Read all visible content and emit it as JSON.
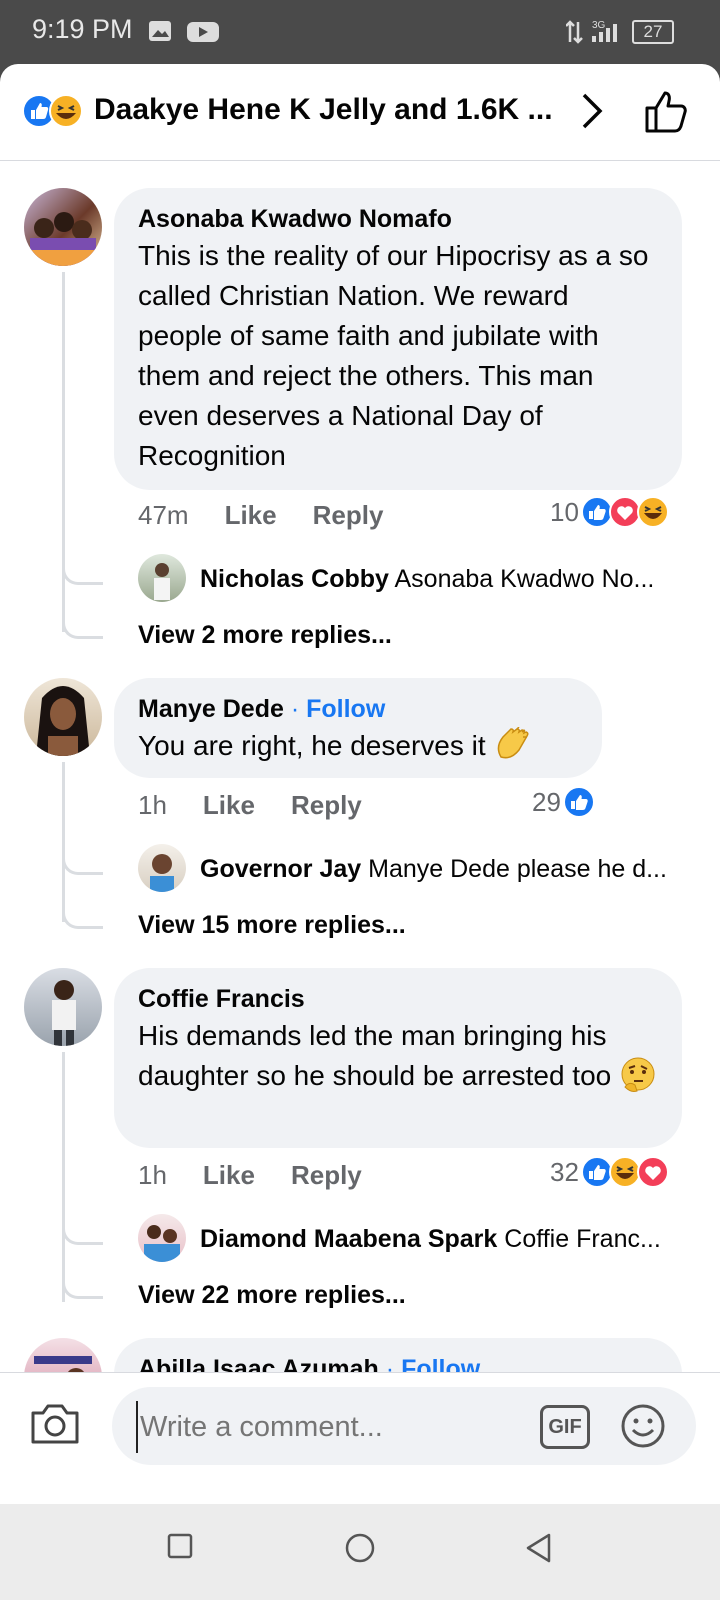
{
  "status_bar": {
    "time": "9:19 PM",
    "network": "3G",
    "battery": "27"
  },
  "header": {
    "title": "Daakye Hene K Jelly and 1.6K ...",
    "reactions": [
      "like-icon",
      "haha-icon"
    ]
  },
  "comments": [
    {
      "author": "Asonaba Kwadwo Nomafo",
      "follow": "",
      "text": "This is the reality of our Hipocrisy as a so called Christian Nation. We reward people of same faith and jubilate with them and reject the others. This man even deserves a National Day of Recognition",
      "time": "47m",
      "like": "Like",
      "reply": "Reply",
      "reaction_count": "10",
      "reactions": [
        "like-icon",
        "love-icon",
        "haha-icon"
      ],
      "reply_preview": {
        "author": "Nicholas Cobby",
        "text": "Asonaba Kwadwo No..."
      },
      "more_replies": "View 2 more replies..."
    },
    {
      "author": "Manye Dede",
      "follow": "Follow",
      "text": "You are right, he deserves it",
      "time": "1h",
      "like": "Like",
      "reply": "Reply",
      "reaction_count": "29",
      "reactions": [
        "like-icon"
      ],
      "reply_preview": {
        "author": "Governor Jay",
        "text": "Manye Dede please he d..."
      },
      "more_replies": "View 15 more replies..."
    },
    {
      "author": "Coffie Francis",
      "follow": "",
      "text": "His demands led the man bringing his daughter so he should be arrested too",
      "time": "1h",
      "like": "Like",
      "reply": "Reply",
      "reaction_count": "32",
      "reactions": [
        "like-icon",
        "haha-icon",
        "love-icon"
      ],
      "reply_preview": {
        "author": "Diamond Maabena Spark",
        "text": "Coffie Franc..."
      },
      "more_replies": "View 22 more replies..."
    },
    {
      "author": "Abilla Isaac Azumah",
      "follow": "Follow"
    }
  ],
  "composer": {
    "placeholder": "Write a comment...",
    "gif_label": "GIF"
  },
  "colors": {
    "accent": "#1877f2",
    "bubble": "#f0f2f5",
    "secondary_text": "#65676b",
    "love": "#f33e58",
    "haha": "#f7b125"
  }
}
